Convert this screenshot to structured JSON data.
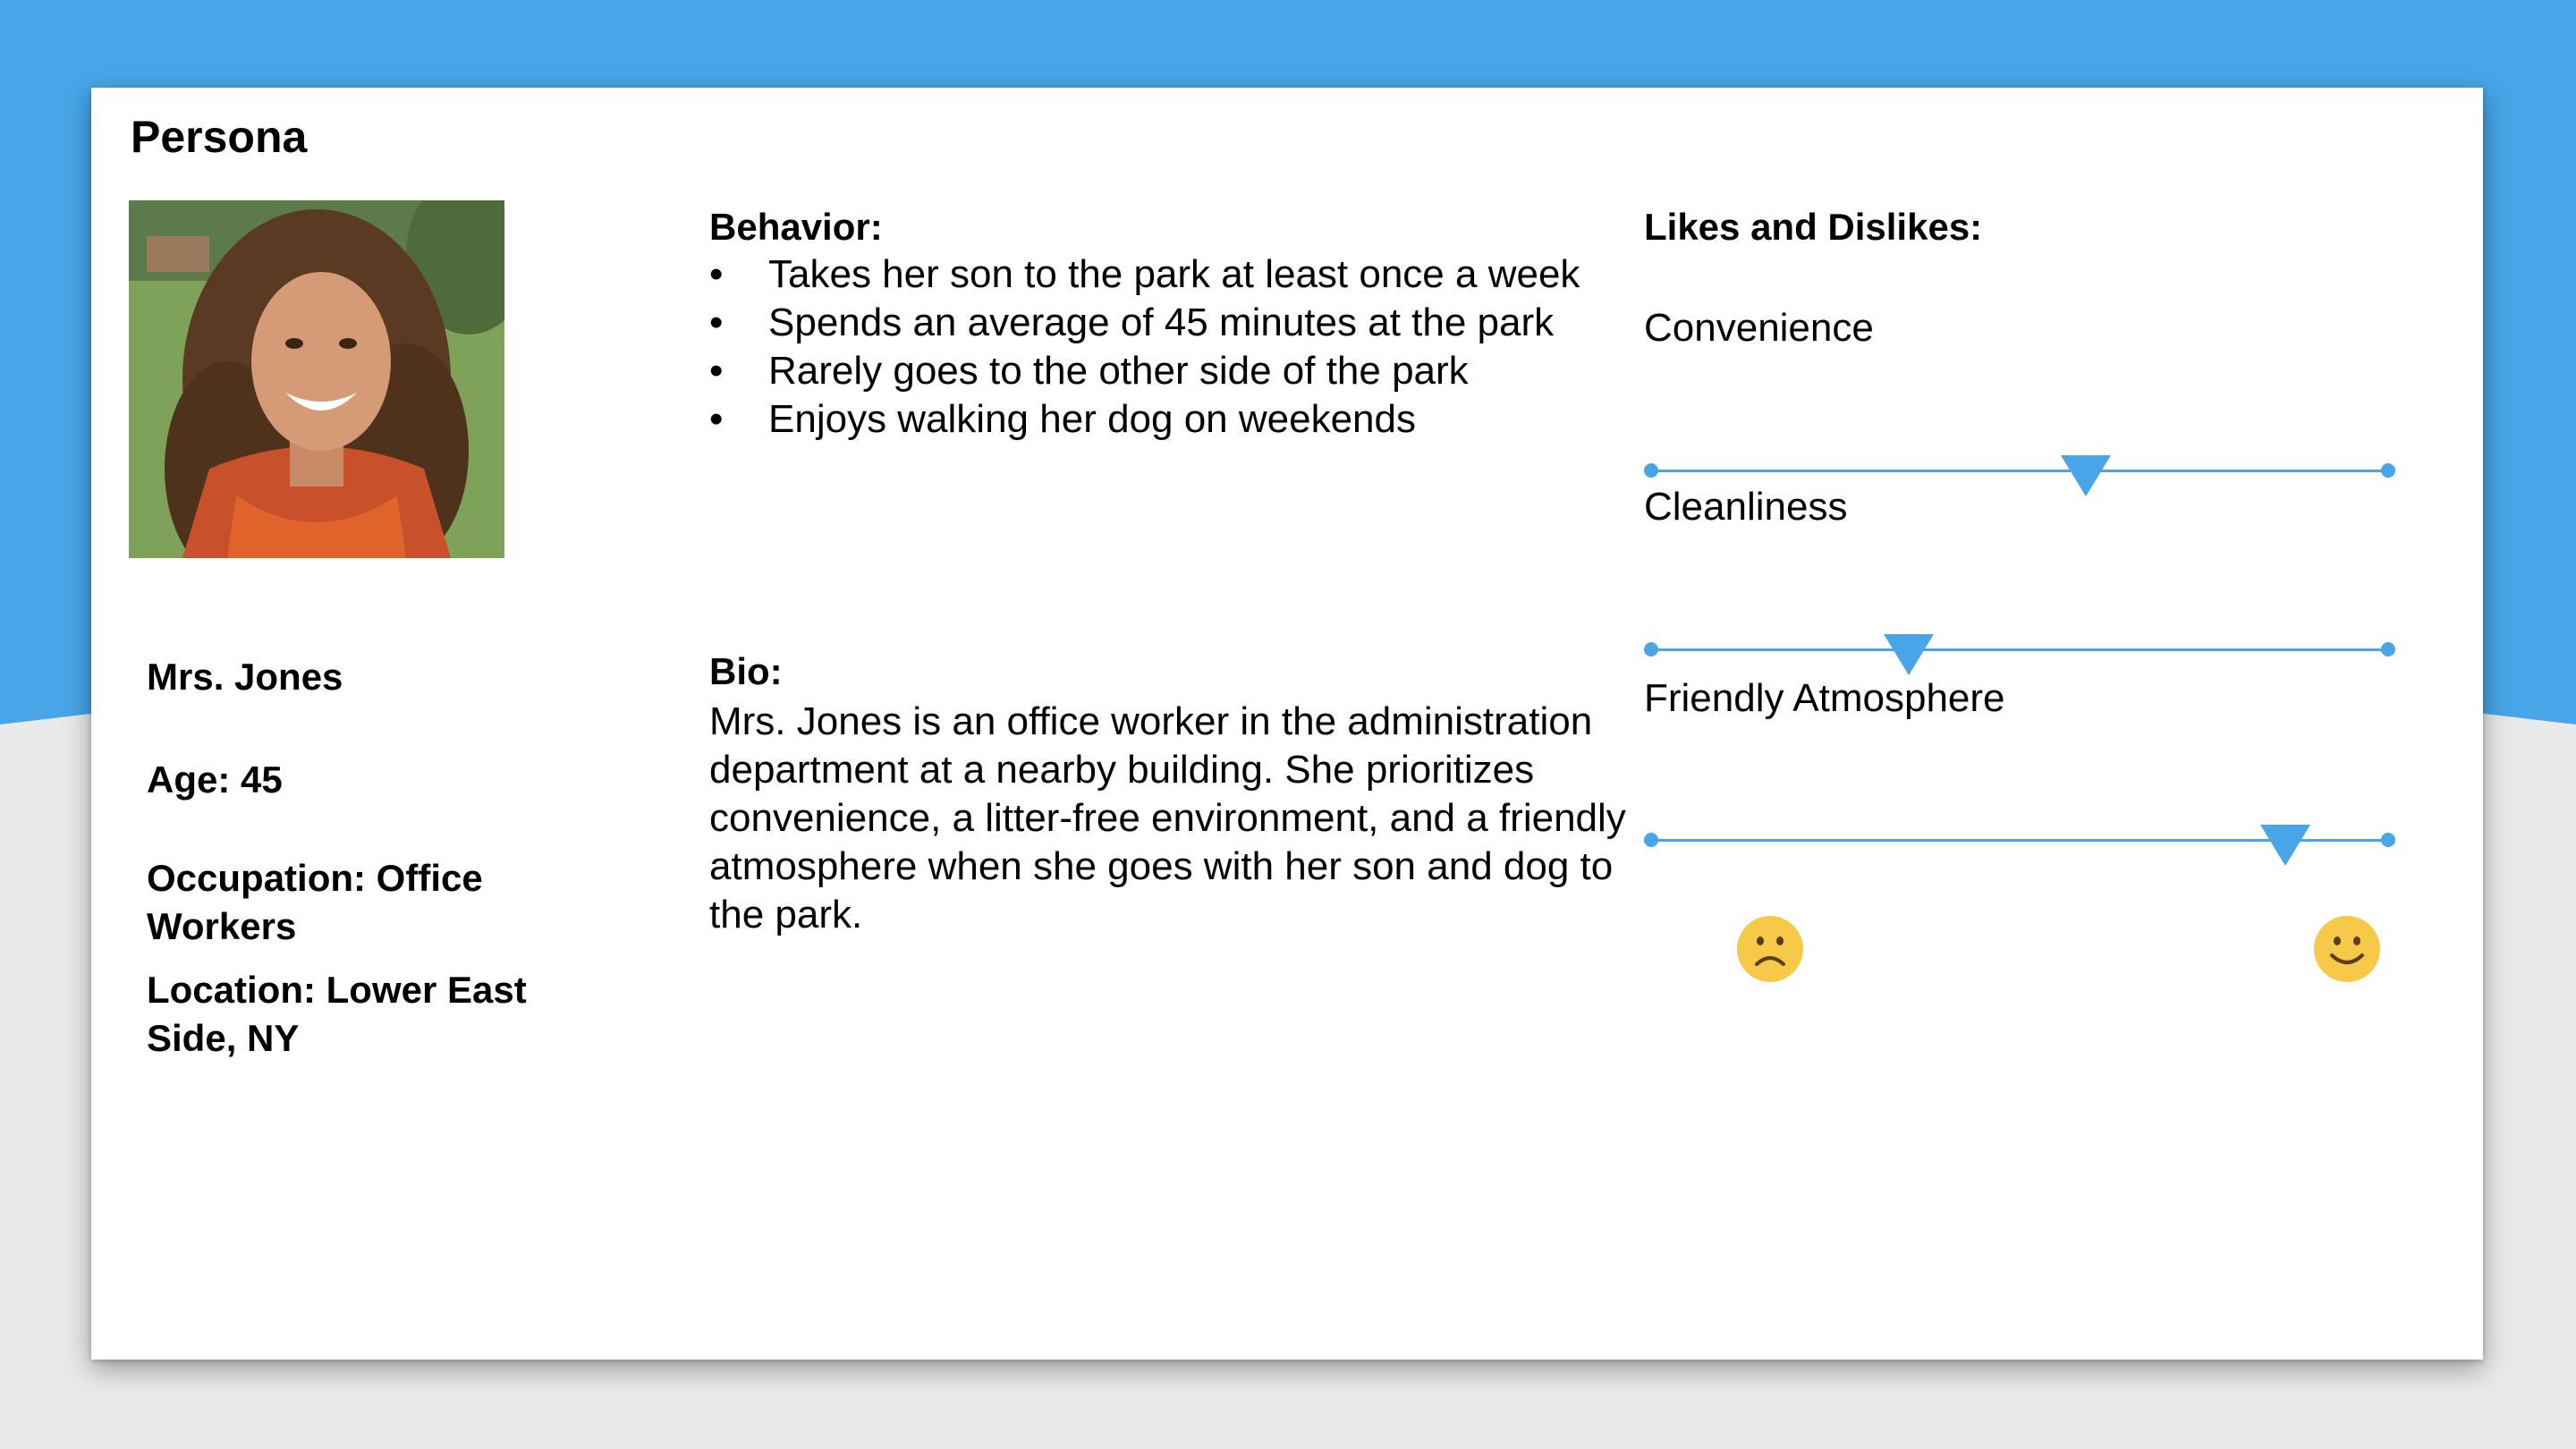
{
  "title": "Persona",
  "profile": {
    "photo_icon": "persona-photo",
    "name": "Mrs. Jones",
    "age": "Age: 45",
    "occupation": "Occupation: Office Workers",
    "location": "Location: Lower East Side, NY"
  },
  "behavior": {
    "title": "Behavior:",
    "bullet": "•",
    "items": [
      "Takes her son to the park at least once a week",
      "Spends an average of 45 minutes at the park",
      "Rarely goes to the other side of the park",
      "Enjoys walking her dog on weekends"
    ]
  },
  "bio": {
    "title": "Bio:",
    "text": "Mrs. Jones is an office worker in the administration department at a nearby building. She prioritizes convenience, a litter-free environment, and a friendly atmosphere when she goes with her son and dog to the park."
  },
  "likes": {
    "title": "Likes and Dislikes:",
    "scales": [
      {
        "label": "Convenience",
        "value": 0.59
      },
      {
        "label": "Cleanliness",
        "value": 0.35
      },
      {
        "label": "Friendly Atmosphere",
        "value": 0.86
      }
    ],
    "min_icon": "sad-face-icon",
    "max_icon": "happy-face-icon"
  },
  "colors": {
    "accent": "#47a5e8",
    "face": "#f7c948",
    "background_band": "#47a5e8",
    "background": "#e9e9ea"
  }
}
